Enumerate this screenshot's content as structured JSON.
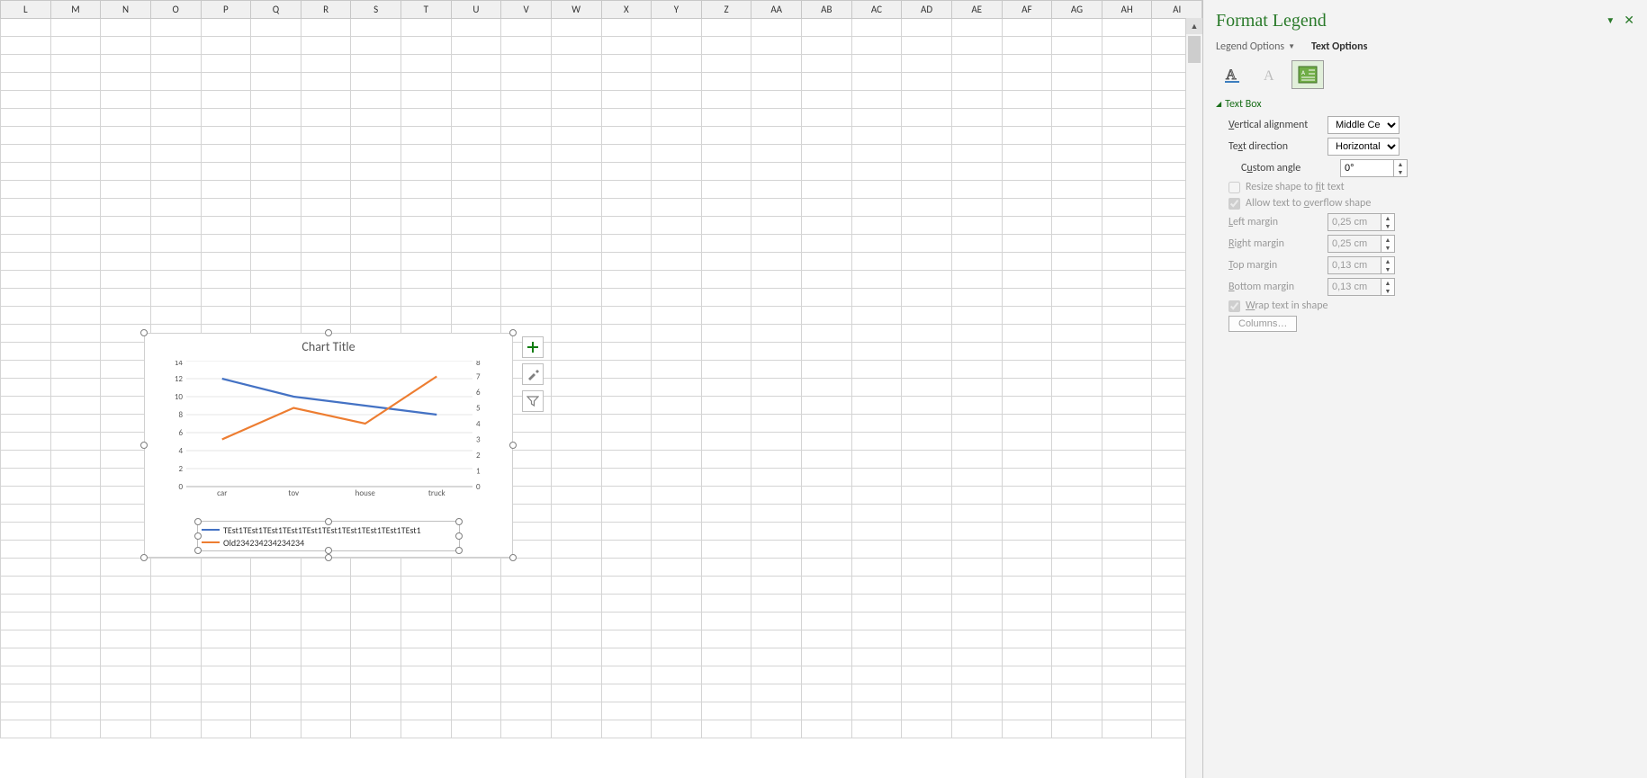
{
  "columns": [
    "L",
    "M",
    "N",
    "O",
    "P",
    "Q",
    "R",
    "S",
    "T",
    "U",
    "V",
    "W",
    "X",
    "Y",
    "Z",
    "AA",
    "AB",
    "AC",
    "AD",
    "AE",
    "AF",
    "AG",
    "AH",
    "AI"
  ],
  "row_count": 40,
  "chart": {
    "title": "Chart Title",
    "side_buttons": [
      "plus-icon",
      "brush-icon",
      "filter-icon"
    ]
  },
  "chart_data": {
    "type": "line",
    "categories": [
      "car",
      "toy",
      "house",
      "truck"
    ],
    "series": [
      {
        "name": "TEst1TEst1TEst1TEst1TEst1TEst1TEst1TEst1TEst1TEst1",
        "values": [
          12,
          10,
          9,
          8
        ],
        "axis": "primary",
        "color": "#4472C4"
      },
      {
        "name": "Old234234234234234",
        "values": [
          3,
          5,
          4,
          7
        ],
        "axis": "secondary",
        "color": "#ED7D31"
      }
    ],
    "title": "Chart Title",
    "ylim_primary": [
      0,
      14
    ],
    "yticks_primary": [
      0,
      2,
      4,
      6,
      8,
      10,
      12,
      14
    ],
    "ylim_secondary": [
      0,
      8
    ],
    "yticks_secondary": [
      0,
      1,
      2,
      3,
      4,
      5,
      6,
      7,
      8
    ],
    "legend_position": "bottom",
    "legend_selected": true
  },
  "pane": {
    "title": "Format Legend",
    "tab_legend_options": "Legend Options",
    "tab_text_options": "Text Options",
    "icon_buttons": [
      "text-fill-outline-icon",
      "text-effects-icon",
      "text-box-icon"
    ],
    "section_textbox": "Text Box",
    "vertical_alignment_label": "Vertical alignment",
    "vertical_alignment_value": "Middle Ce…",
    "text_direction_label": "Text direction",
    "text_direction_value": "Horizontal",
    "custom_angle_label": "Custom angle",
    "custom_angle_value": "0°",
    "resize_fit_label": "Resize shape to fit text",
    "overflow_label": "Allow text to overflow shape",
    "left_margin_label": "Left margin",
    "left_margin_value": "0,25 cm",
    "right_margin_label": "Right margin",
    "right_margin_value": "0,25 cm",
    "top_margin_label": "Top margin",
    "top_margin_value": "0,13 cm",
    "bottom_margin_label": "Bottom margin",
    "bottom_margin_value": "0,13 cm",
    "wrap_label": "Wrap text in shape",
    "columns_button": "Columns…"
  }
}
